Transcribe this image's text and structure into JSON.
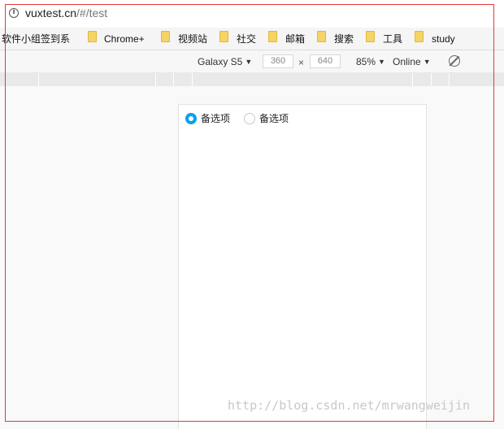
{
  "address_bar": {
    "host": "vuxtest.cn",
    "path": "/#/test"
  },
  "bookmarks": [
    {
      "label": "软件小组签到系",
      "icon": "none"
    },
    {
      "label": "Chrome+",
      "icon": "folder-icon"
    },
    {
      "label": "视频站",
      "icon": "folder-icon"
    },
    {
      "label": "社交",
      "icon": "folder-icon"
    },
    {
      "label": "邮箱",
      "icon": "folder-icon"
    },
    {
      "label": "搜索",
      "icon": "folder-icon"
    },
    {
      "label": "工具",
      "icon": "folder-icon"
    },
    {
      "label": "study",
      "icon": "folder-icon"
    }
  ],
  "device_toolbar": {
    "device": "Galaxy S5",
    "width": "360",
    "times": "×",
    "height": "640",
    "zoom": "85%",
    "network": "Online",
    "caret": "▼"
  },
  "page": {
    "radio_options": [
      {
        "label": "备选项",
        "checked": true
      },
      {
        "label": "备选项",
        "checked": false
      }
    ],
    "accent_color": "#09a0ef"
  },
  "watermark": "http://blog.csdn.net/mrwangweijin"
}
